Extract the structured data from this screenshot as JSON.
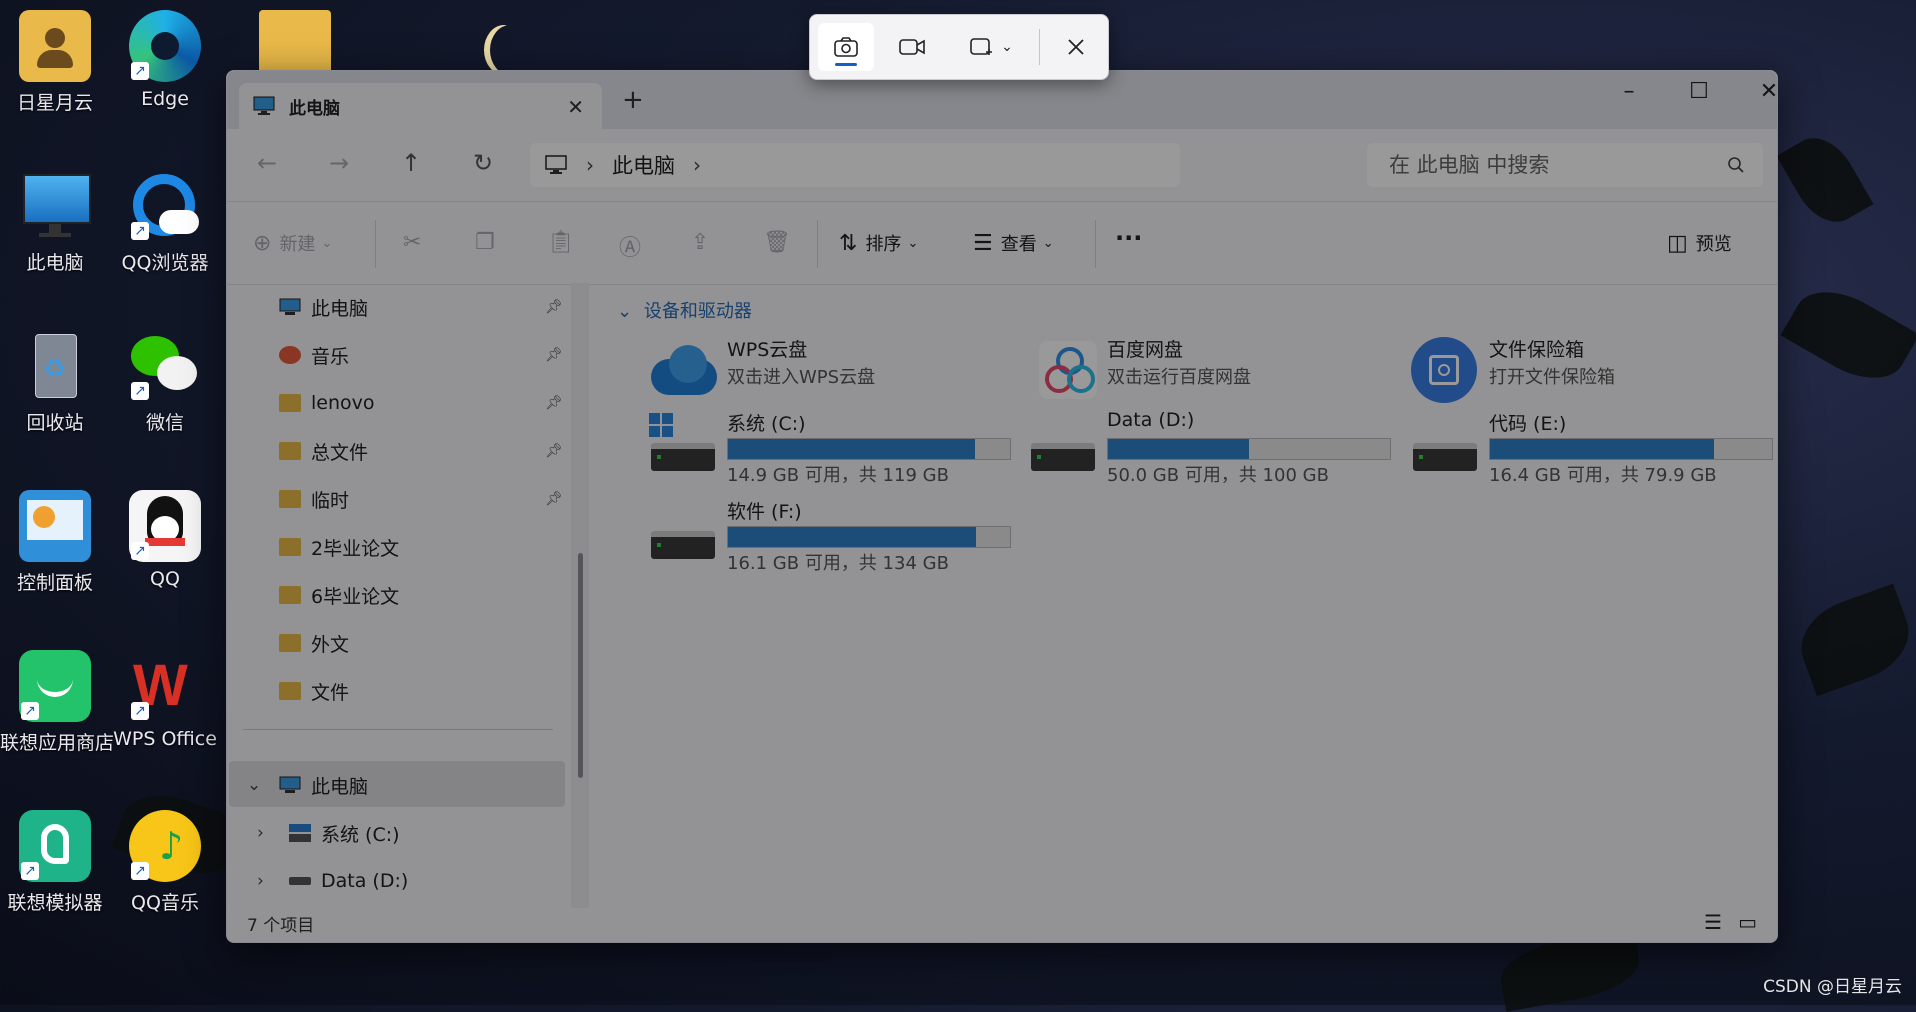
{
  "desktop": {
    "icons": [
      {
        "label": "日星月云",
        "icon": "user-folder-icon"
      },
      {
        "label": "Edge",
        "icon": "edge-icon"
      },
      {
        "label": "此电脑",
        "icon": "computer-icon"
      },
      {
        "label": "QQ浏览器",
        "icon": "qq-browser-icon"
      },
      {
        "label": "回收站",
        "icon": "recycle-bin-icon"
      },
      {
        "label": "微信",
        "icon": "wechat-icon"
      },
      {
        "label": "控制面板",
        "icon": "control-panel-icon"
      },
      {
        "label": "QQ",
        "icon": "qq-icon"
      },
      {
        "label": "联想应用商店",
        "icon": "lenovo-store-icon"
      },
      {
        "label": "WPS Office",
        "icon": "wps-icon"
      },
      {
        "label": "联想模拟器",
        "icon": "lenovo-emulator-icon"
      },
      {
        "label": "QQ音乐",
        "icon": "qq-music-icon"
      }
    ],
    "watermark": "CSDN @日星月云"
  },
  "snip_toolbar": {
    "colors": {
      "accent": "#1560c4"
    }
  },
  "explorer": {
    "tab_title": "此电脑",
    "address": {
      "crumb": "此电脑"
    },
    "search": {
      "placeholder": "在 此电脑 中搜索"
    },
    "commands": {
      "new": "新建",
      "sort": "排序",
      "view": "查看",
      "more": "···",
      "preview": "预览"
    },
    "nav": {
      "quick": [
        {
          "label": "此电脑",
          "pinned": true
        },
        {
          "label": "音乐",
          "pinned": true
        },
        {
          "label": "lenovo",
          "pinned": true
        },
        {
          "label": "总文件",
          "pinned": true
        },
        {
          "label": "临时",
          "pinned": true
        },
        {
          "label": "2毕业论文",
          "pinned": false
        },
        {
          "label": "6毕业论文",
          "pinned": false
        },
        {
          "label": "外文",
          "pinned": false
        },
        {
          "label": "文件",
          "pinned": false
        }
      ],
      "tree": [
        {
          "label": "此电脑"
        },
        {
          "label": "系统 (C:)"
        },
        {
          "label": "Data (D:)"
        }
      ]
    },
    "group_title": "设备和驱动器",
    "cloud": [
      {
        "name": "WPS云盘",
        "sub": "双击进入WPS云盘"
      },
      {
        "name": "百度网盘",
        "sub": "双击运行百度网盘"
      },
      {
        "name": "文件保险箱",
        "sub": "打开文件保险箱"
      }
    ],
    "drives": [
      {
        "name": "系统 (C:)",
        "caption": "14.9 GB 可用，共 119 GB",
        "used_fraction": 0.875
      },
      {
        "name": "Data (D:)",
        "caption": "50.0 GB 可用，共 100 GB",
        "used_fraction": 0.5
      },
      {
        "name": "代码 (E:)",
        "caption": "16.4 GB 可用，共 79.9 GB",
        "used_fraction": 0.795
      },
      {
        "name": "软件 (F:)",
        "caption": "16.1 GB 可用，共 134 GB",
        "used_fraction": 0.88
      }
    ],
    "status": "7 个项目",
    "colors": {
      "accent": "#2f7fc8",
      "group": "#2b6bb5"
    }
  }
}
